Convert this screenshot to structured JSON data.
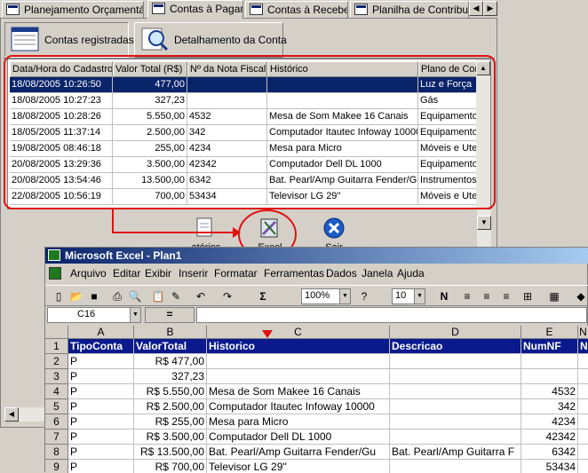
{
  "tabs": [
    {
      "label": "Planejamento Orçamentário"
    },
    {
      "label": "Contas à Pagar"
    },
    {
      "label": "Contas à Receber"
    },
    {
      "label": "Planilha de Contribuição"
    }
  ],
  "subtabs": [
    {
      "label": "Contas registradas"
    },
    {
      "label": "Detalhamento da Conta"
    }
  ],
  "grid": {
    "columns": [
      "Data/Hora do Cadastro",
      "Valor Total (R$)",
      "Nº da Nota Fiscal",
      "Histórico",
      "Plano de Con"
    ],
    "rows": [
      [
        "18/08/2005 10:26:50",
        "477,00",
        "",
        "",
        "Luz e Força"
      ],
      [
        "18/08/2005 10:27:23",
        "327,23",
        "",
        "",
        "Gás"
      ],
      [
        "18/08/2005 10:28:26",
        "5.550,00",
        "4532",
        "Mesa de Som  Makee 16 Canais",
        "Equipamento"
      ],
      [
        "18/05/2005 11:37:14",
        "2.500,00",
        "342",
        "Computador Itautec Infoway 10000",
        "Equipamento"
      ],
      [
        "19/08/2005 08:46:18",
        "255,00",
        "4234",
        "Mesa para Micro",
        "Móveis e Ute"
      ],
      [
        "20/08/2005 13:29:36",
        "3.500,00",
        "42342",
        "Computador Dell DL 1000",
        "Equipamento"
      ],
      [
        "20/08/2005 13:54:46",
        "13.500,00",
        "6342",
        "Bat. Pearl/Amp Guitarra Fender/Gu",
        "Instrumentos"
      ],
      [
        "22/08/2005 10:56:19",
        "700,00",
        "53434",
        "Televisor LG 29''",
        "Móveis e Ute"
      ]
    ]
  },
  "actions": {
    "relatorios": "atórios",
    "excel": "Excel",
    "sair": "Sair"
  },
  "excel": {
    "title": "Microsoft Excel - Plan1",
    "menu": [
      "Arquivo",
      "Editar",
      "Exibir",
      "Inserir",
      "Formatar",
      "Ferramentas",
      "Dados",
      "Janela",
      "Ajuda"
    ],
    "zoom": "100%",
    "font_size": "10",
    "namebox": "C16",
    "fx": "=",
    "col_headers": [
      "A",
      "B",
      "C",
      "D",
      "E",
      "N"
    ],
    "row_numbers": [
      "1",
      "2",
      "3",
      "4",
      "5",
      "6",
      "7",
      "8",
      "9"
    ],
    "header_row": [
      "TipoConta",
      "ValorTotal",
      "Historico",
      "Descricao",
      "NumNF",
      "N"
    ],
    "rows": [
      [
        "P",
        "R$ 477,00",
        "",
        "",
        ""
      ],
      [
        "P",
        "327,23",
        "",
        "",
        ""
      ],
      [
        "P",
        "R$ 5.550,00",
        "Mesa de Som  Makee 16 Canais",
        "",
        "4532"
      ],
      [
        "P",
        "R$ 2.500,00",
        "Computador Itautec Infoway 10000",
        "",
        "342"
      ],
      [
        "P",
        "R$ 255,00",
        "Mesa para Micro",
        "",
        "4234"
      ],
      [
        "P",
        "R$ 3.500,00",
        "Computador Dell DL 1000",
        "",
        "42342"
      ],
      [
        "P",
        "R$ 13.500,00",
        "Bat. Pearl/Amp Guitarra Fender/Gu",
        "Bat. Pearl/Amp Guitarra F",
        "6342"
      ],
      [
        "P",
        "R$ 700,00",
        "Televisor LG 29''",
        "",
        "53434"
      ]
    ]
  },
  "colors": {
    "highlight": "#e01010",
    "selection": "#0a246a",
    "excel_header": "#0a1a8c"
  }
}
